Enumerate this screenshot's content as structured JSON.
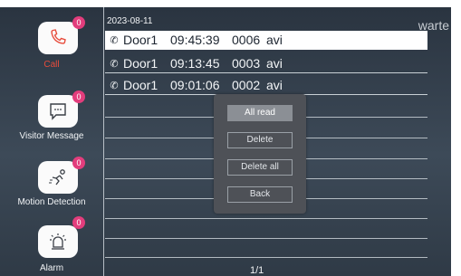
{
  "watermark": "warte",
  "sidebar": {
    "items": [
      {
        "label": "Call",
        "badge": "0",
        "icon": "phone-icon",
        "active": true
      },
      {
        "label": "Visitor Message",
        "badge": "0",
        "icon": "message-icon",
        "active": false
      },
      {
        "label": "Motion Detection",
        "badge": "0",
        "icon": "motion-icon",
        "active": false
      },
      {
        "label": "Alarm",
        "badge": "0",
        "icon": "alarm-icon",
        "active": false
      }
    ]
  },
  "list": {
    "date": "2023-08-11",
    "rows": [
      {
        "source": "Door1",
        "time": "09:45:39",
        "number": "0006",
        "type": "avi"
      },
      {
        "source": "Door1",
        "time": "09:13:45",
        "number": "0003",
        "type": "avi"
      },
      {
        "source": "Door1",
        "time": "09:01:06",
        "number": "0002",
        "type": "avi"
      }
    ],
    "pager": "1/1"
  },
  "popup": {
    "all_read": "All read",
    "delete": "Delete",
    "delete_all": "Delete all",
    "back": "Back"
  },
  "colors": {
    "active": "#e74c3c",
    "badge": "#e23d7c",
    "popup_bg": "#4e5157",
    "popup_highlight": "#8b8f95"
  }
}
